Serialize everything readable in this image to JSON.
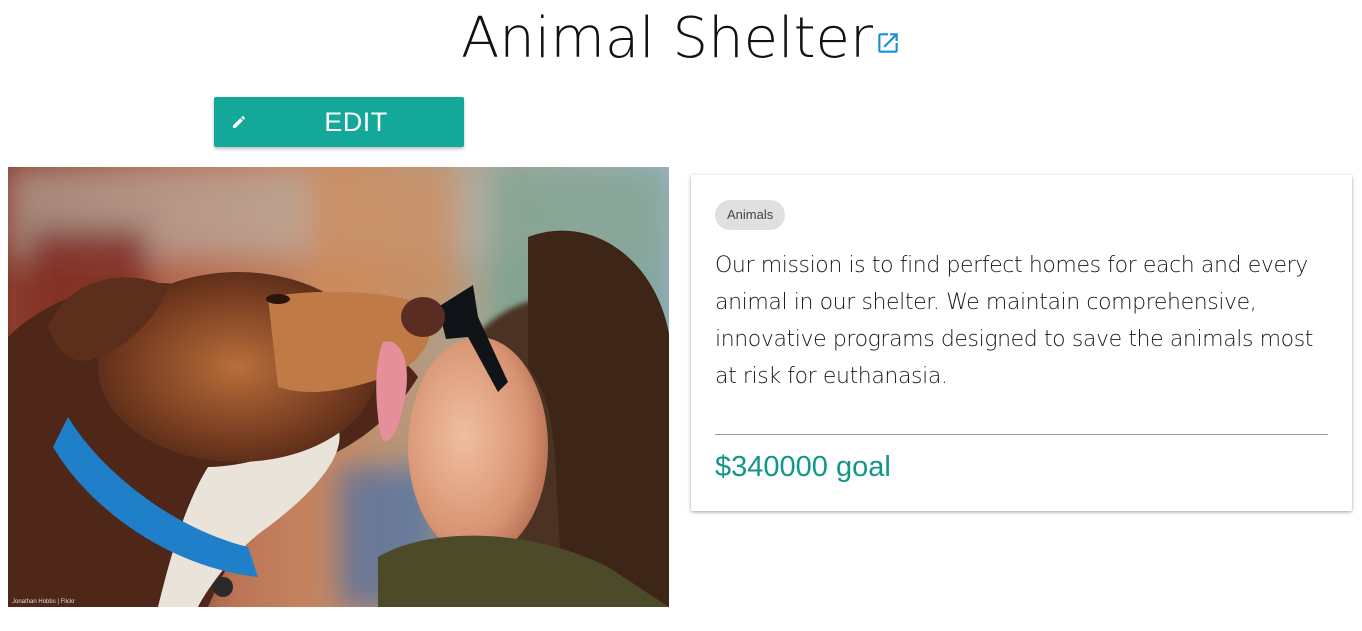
{
  "header": {
    "title": "Animal Shelter",
    "external_link_icon": "external-link-icon",
    "icon_color": "#1a8fd6"
  },
  "toolbar": {
    "edit_label": "EDIT",
    "edit_icon": "pencil-icon",
    "button_color": "#13a89a"
  },
  "photo": {
    "alt": "Dog licking man's face",
    "caption": "Jonathan Hobbs | Flickr"
  },
  "card": {
    "category": "Animals",
    "mission": "Our mission is to find perfect homes for each and every animal in our shelter. We maintain comprehensive, innovative programs designed to save the animals most at risk for euthanasia.",
    "goal": "$340000 goal",
    "goal_color": "#13968a"
  }
}
